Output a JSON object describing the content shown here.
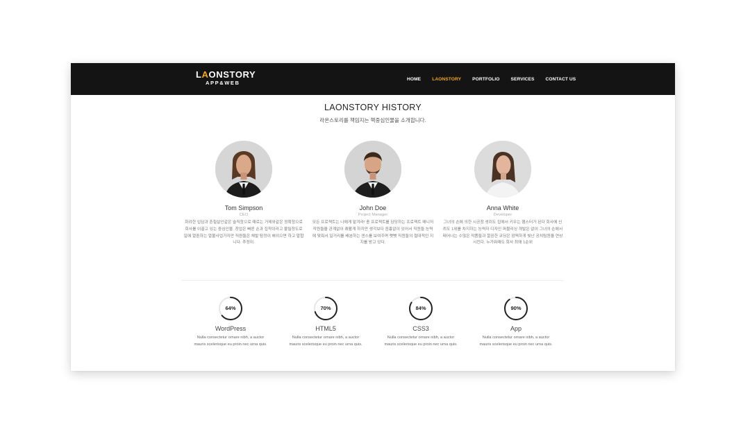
{
  "nav": {
    "logo_lead": "L",
    "logo_accent": "A",
    "logo_rest": "ONSTORY",
    "logo_sub": "APP&WEB",
    "items": [
      {
        "label": "HOME",
        "active": false
      },
      {
        "label": "LAONSTORY",
        "active": true
      },
      {
        "label": "PORTFOLIO",
        "active": false
      },
      {
        "label": "SERVICES",
        "active": false
      },
      {
        "label": "CONTACT US",
        "active": false
      }
    ]
  },
  "history": {
    "title": "LAONSTORY HISTORY",
    "subtitle": "라온스토리를 책임지는 핵중심인물을 소개합니다."
  },
  "members": [
    {
      "name": "Tom Simpson",
      "role": "CEO",
      "desc": "화려한 입담과 촌철살인같은 솔직함으로 때로는 거제와같은 정확함으로 회사를 이끌고 있는 중심인물. 창업은 빠른 손과 집착이라고 불릴정도로 일에 열중하는 열불사업가지만 직원들은 채발 탐정이 해외으면 하고 말합니다. 추정이."
    },
    {
      "name": "John Doe",
      "role": "Project Manager",
      "desc": "모든 프로젝트는 나에게 맡겨라! 총 프로젝트를 담당하는 프로젝트 매니저 작원들을 관계없이 쾌활게 하지만 생각보다 음흉없이 있어서 직원들 능력에 맞춰서 일거리를 배분하는 센스를 보여주며 뻣뻣 직원들의 절대적인 지지를 받고 있다."
    },
    {
      "name": "Anna White",
      "role": "Developer",
      "desc": "그녀의 손에 의한 시공창 생쥐도 집에서 키우는 햄스터가 된다 회사에 신뢰도 1위를 차지하는 능력자 디자인 퍼블리싱 개발은 없이 그녀의 손에서 태어나는 수많은 작품들과 깔끔한 코딩은 깜찍하게 빛난 공치팀원을 연상시킨다. 누가뭐래도 회사 최애 1순위"
    }
  ],
  "skills": [
    {
      "percent": 64,
      "label": "64%",
      "name": "WordPress",
      "desc_line1": "Nulla consectetur ornare nibh, a auctor",
      "desc_line2": "mauris scelerisque eu proin nec urna quis."
    },
    {
      "percent": 70,
      "label": "70%",
      "name": "HTML5",
      "desc_line1": "Nulla consectetur ornare nibh, a auctor",
      "desc_line2": "mauris scelerisque eu proin nec urna quis."
    },
    {
      "percent": 84,
      "label": "84%",
      "name": "CSS3",
      "desc_line1": "Nulla consectetur ornare nibh, a auctor",
      "desc_line2": "mauris scelerisque eu proin nec urna quis."
    },
    {
      "percent": 90,
      "label": "90%",
      "name": "App",
      "desc_line1": "Nulla consectetur ornare nibh, a auctor",
      "desc_line2": "mauris scelerisque eu proin nec urna quis."
    }
  ],
  "colors": {
    "nav_bg": "#141414",
    "accent": "#f5a623",
    "ring_track": "#e6e6e6",
    "ring_fill": "#222222"
  }
}
